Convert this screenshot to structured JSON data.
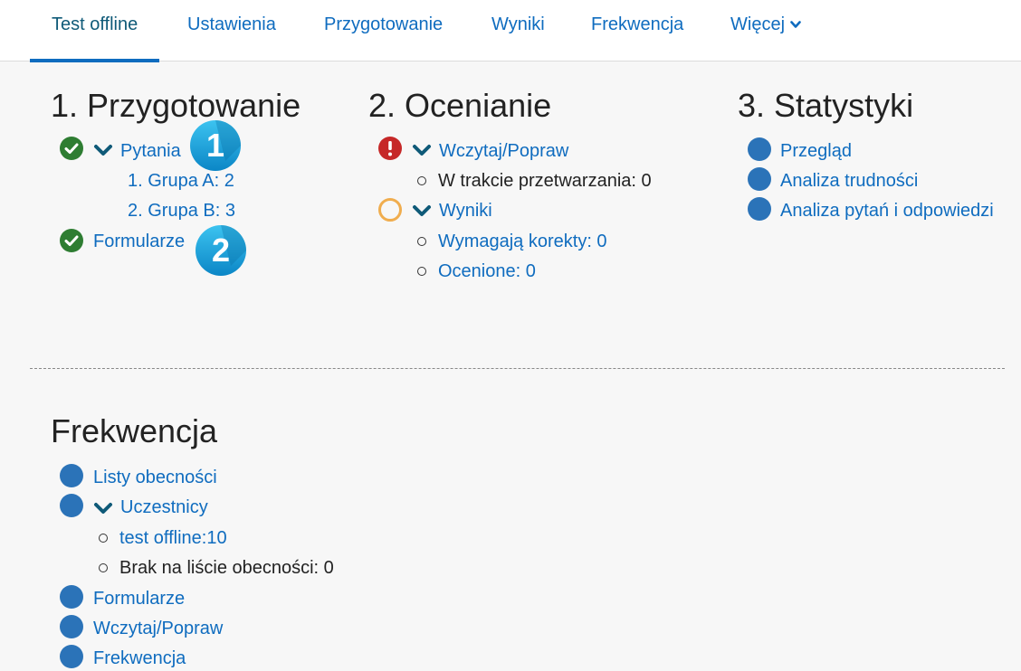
{
  "nav": {
    "tabs": [
      "Test offline",
      "Ustawienia",
      "Przygotowanie",
      "Wyniki",
      "Frekwencja",
      "Więcej"
    ]
  },
  "prep": {
    "title": "1. Przygotowanie",
    "questions": "Pytania",
    "group_a": "1. Grupa A: 2",
    "group_b": "2. Grupa B: 3",
    "forms": "Formularze",
    "badge1": "1",
    "badge2": "2"
  },
  "grading": {
    "title": "2. Ocenianie",
    "upload": "Wczytaj/Popraw",
    "processing": "W trakcie przetwarzania: 0",
    "results": "Wyniki",
    "needs_correction": "Wymagają korekty: 0",
    "graded": "Ocenione: 0"
  },
  "stats": {
    "title": "3. Statystyki",
    "overview": "Przegląd",
    "difficulty": "Analiza trudności",
    "qa_analysis": "Analiza pytań i odpowiedzi"
  },
  "attendance": {
    "title": "Frekwencja",
    "lists": "Listy obecności",
    "participants": "Uczestnicy",
    "offline": "test offline:10",
    "missing": "Brak na liście obecności: 0",
    "forms": "Formularze",
    "upload": "Wczytaj/Popraw",
    "attendance": "Frekwencja"
  },
  "colors": {
    "link": "#0f6cbf",
    "success": "#2e7d32",
    "error": "#c62828",
    "pending": "#f0ad4e",
    "dot": "#2b73b8",
    "badge": "#1aa0d8"
  }
}
